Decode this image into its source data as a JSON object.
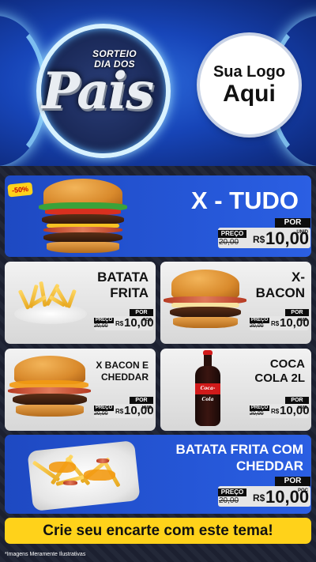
{
  "header": {
    "emblem_top": "SORTEIO\nDIA DOS",
    "emblem_big": "Pais",
    "logo_line1": "Sua Logo",
    "logo_line2": "Aqui"
  },
  "badge": "-50%",
  "products": {
    "x_tudo": {
      "name": "X - TUDO",
      "por": "POR",
      "preco": "PREÇO",
      "old": "20,00",
      "currency": "R$",
      "price": "10,00",
      "unit": "UNID"
    },
    "batata_frita": {
      "name_l1": "BATATA",
      "name_l2": "FRITA",
      "por": "POR",
      "preco": "PREÇO",
      "old": "20,00",
      "currency": "R$",
      "price": "10,00",
      "unit": "POÇ"
    },
    "x_bacon": {
      "name_l1": "X-",
      "name_l2": "BACON",
      "por": "POR",
      "preco": "PREÇO",
      "old": "20,00",
      "currency": "R$",
      "price": "10,00",
      "unit": "UNID"
    },
    "x_bacon_cheddar": {
      "name_l1": "X BACON E",
      "name_l2": "CHEDDAR",
      "por": "POR",
      "preco": "PREÇO",
      "old": "20,00",
      "currency": "R$",
      "price": "10,00",
      "unit": "UNID"
    },
    "coca_cola": {
      "name_l1": "COCA",
      "name_l2": "COLA 2L",
      "por": "POR",
      "preco": "PREÇO",
      "old": "20,00",
      "currency": "R$",
      "price": "10,00",
      "unit": "UNID",
      "label": "Coca-Cola"
    },
    "batata_cheddar": {
      "name_l1": "BATATA FRITA COM",
      "name_l2": "CHEDDAR",
      "por": "POR",
      "preco": "PREÇO",
      "old": "20,00",
      "currency": "R$",
      "price": "10,00",
      "unit": "POÇ"
    }
  },
  "cta": "Crie seu encarte com este tema!",
  "disclaimer": "*Imagens Meramente Ilustrativas",
  "colors": {
    "blue": "#2556d6",
    "yellow": "#ffd21a",
    "grey": "#e6e6e6",
    "red": "#d11a1a"
  }
}
